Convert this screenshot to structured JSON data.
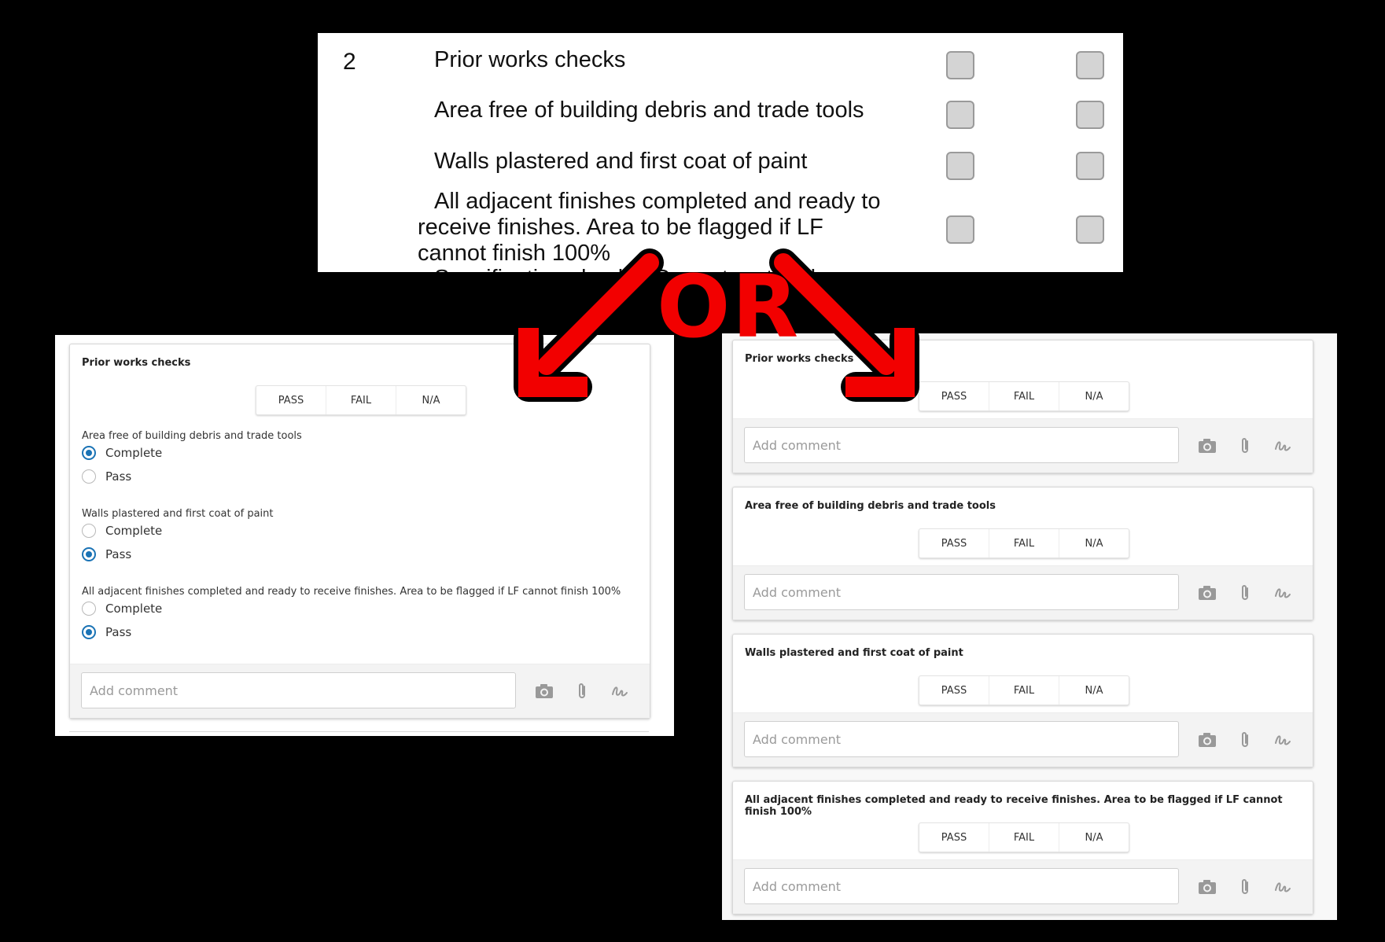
{
  "top_form": {
    "number": "2",
    "rows": [
      {
        "text": "Prior works checks"
      },
      {
        "text": "Area free of building debris and trade tools"
      },
      {
        "text": "Walls plastered and first coat of paint"
      },
      {
        "text_lines": [
          "All adjacent finishes completed and ready to",
          "receive finishes. Area to be flagged if LF",
          "cannot finish 100%"
        ]
      }
    ],
    "cut_off_text": "Specification checks: Correct material"
  },
  "divider_label": "OR",
  "accent_color": "#f20000",
  "radio_color": "#1a73b5",
  "left_panel": {
    "card_title": "Prior works checks",
    "segmented": [
      "PASS",
      "FAIL",
      "N/A"
    ],
    "questions": [
      {
        "label": "Area free of building debris and trade tools",
        "options": [
          "Complete",
          "Pass"
        ],
        "selected": "Complete"
      },
      {
        "label": "Walls plastered and first coat of paint",
        "options": [
          "Complete",
          "Pass"
        ],
        "selected": "Pass"
      },
      {
        "label": "All adjacent finishes completed and ready to receive finishes. Area to be flagged if LF cannot finish 100%",
        "options": [
          "Complete",
          "Pass"
        ],
        "selected": "Pass"
      }
    ],
    "comment_placeholder": "Add comment",
    "icons": [
      "camera-icon",
      "paperclip-icon",
      "signature-icon"
    ]
  },
  "right_panel": {
    "segmented": [
      "PASS",
      "FAIL",
      "N/A"
    ],
    "comment_placeholder": "Add comment",
    "icons": [
      "camera-icon",
      "paperclip-icon",
      "signature-icon"
    ],
    "cards": [
      {
        "title": "Prior works checks"
      },
      {
        "title": "Area free of building debris and trade tools"
      },
      {
        "title": "Walls plastered and first coat of paint"
      },
      {
        "title": "All adjacent finishes completed and ready to receive finishes. Area to be flagged if LF cannot finish 100%"
      }
    ]
  }
}
